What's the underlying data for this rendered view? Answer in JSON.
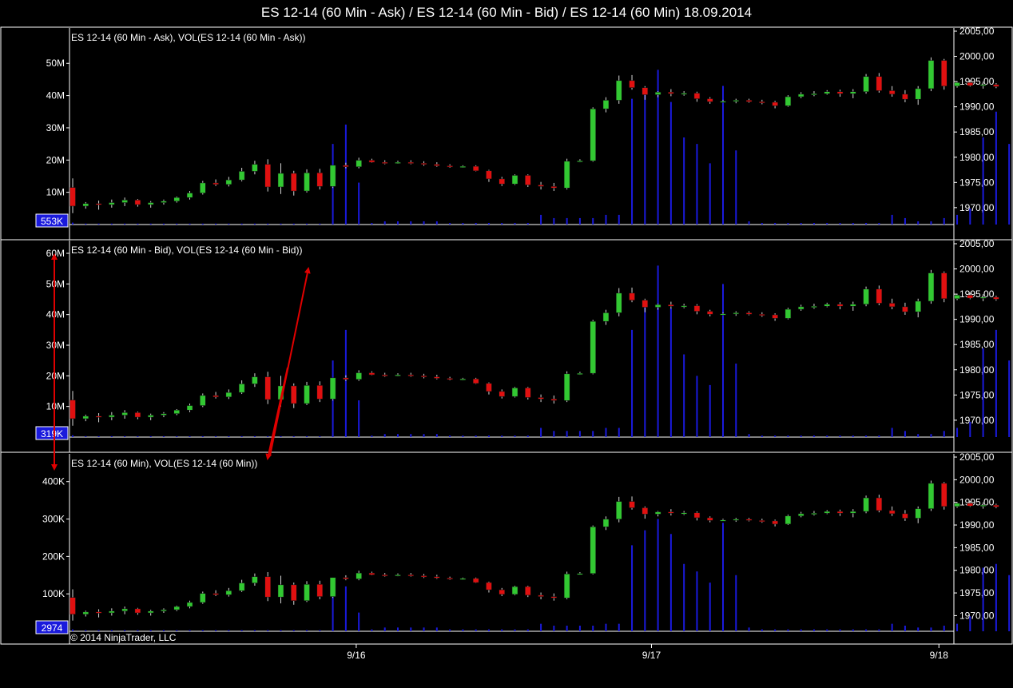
{
  "window": {
    "title": "ES 12-14 (60 Min - Ask) / ES 12-14 (60 Min - Bid) / ES 12-14 (60 Min)  18.09.2014",
    "copyright": "© 2014 NinjaTrader, LLC"
  },
  "colors": {
    "up": "#32c832",
    "down": "#e01010",
    "volume": "#1a1adc",
    "grid_line": "#ffffff",
    "annotation": "#e00000",
    "badge": "#1a1adc"
  },
  "chart_data": [
    {
      "type": "candlestick-with-volume",
      "title": "ES 12-14 (60 Min - Ask), VOL(ES 12-14 (60 Min - Ask))",
      "price_ticks": [
        "2005,00",
        "2000,00",
        "1995,00",
        "1990,00",
        "1985,00",
        "1980,00",
        "1975,00",
        "1970,00"
      ],
      "price_ylim": [
        1967.6,
        2005.0
      ],
      "volume_ticks": [
        "50M",
        "40M",
        "30M",
        "20M",
        "10M"
      ],
      "volume_ylim": [
        0,
        57
      ],
      "last_volume_label": "553K",
      "volume_unit": "M",
      "volume": [
        0.6,
        0.3,
        0.3,
        0.3,
        0.3,
        0.3,
        0.3,
        0.3,
        0.3,
        0.3,
        0.3,
        0.3,
        0.3,
        0.3,
        0.3,
        0.3,
        0.3,
        0.3,
        0.3,
        0.3,
        25,
        31,
        13,
        0.5,
        1,
        1,
        1,
        1,
        1,
        0.5,
        0.5,
        0.5,
        0.5,
        0.5,
        0.5,
        0.5,
        3,
        2,
        2,
        2,
        2,
        3,
        3,
        39,
        42,
        48,
        38,
        27,
        25,
        19,
        43,
        23,
        1,
        0.5,
        0.5,
        0.5,
        0.5,
        0.5,
        0.5,
        0.5,
        0.5,
        0.5,
        0.5,
        3,
        2,
        1,
        1,
        2,
        3,
        5,
        27,
        35,
        25,
        13,
        12,
        21,
        25,
        52,
        17,
        0.5
      ]
    },
    {
      "type": "candlestick-with-volume",
      "title": "ES 12-14 (60 Min - Bid), VOL(ES 12-14 (60 Min - Bid))",
      "price_ticks": [
        "2005,00",
        "2000,00",
        "1995,00",
        "1990,00",
        "1985,00",
        "1980,00",
        "1975,00",
        "1970,00"
      ],
      "price_ylim": [
        1967.6,
        2005.0
      ],
      "volume_ticks": [
        "60M",
        "50M",
        "40M",
        "30M",
        "20M",
        "10M"
      ],
      "volume_ylim": [
        0,
        60
      ],
      "last_volume_label": "319K",
      "volume_unit": "M",
      "volume": [
        0.6,
        0.3,
        0.3,
        0.3,
        0.3,
        0.3,
        0.3,
        0.3,
        0.3,
        0.3,
        0.3,
        0.3,
        0.3,
        0.3,
        0.3,
        0.3,
        0.3,
        0.3,
        0.3,
        0.3,
        25,
        35,
        12,
        0.5,
        1,
        1,
        1,
        1,
        1,
        0.5,
        0.5,
        0.5,
        0.5,
        0.5,
        0.5,
        0.5,
        3,
        2,
        2,
        2,
        2,
        3,
        3,
        35,
        44,
        56,
        42,
        27,
        20,
        17,
        50,
        24,
        1,
        0.5,
        0.5,
        0.5,
        0.5,
        0.5,
        0.5,
        0.5,
        0.5,
        0.5,
        0.5,
        3,
        2,
        1,
        1,
        2,
        3,
        5,
        29,
        35,
        25,
        13,
        12,
        20,
        25,
        57,
        16,
        0.5
      ]
    },
    {
      "type": "candlestick-with-volume",
      "title": "ES 12-14 (60 Min), VOL(ES 12-14 (60 Min))",
      "price_ticks": [
        "2005,00",
        "2000,00",
        "1995,00",
        "1990,00",
        "1985,00",
        "1980,00",
        "1975,00",
        "1970,00"
      ],
      "price_ylim": [
        1967.6,
        2005.0
      ],
      "volume_ticks": [
        "400K",
        "300K",
        "200K",
        "100K"
      ],
      "volume_ylim": [
        0,
        440
      ],
      "last_volume_label": "2974",
      "volume_unit": "K",
      "volume": [
        5,
        3,
        3,
        3,
        3,
        3,
        3,
        3,
        3,
        3,
        3,
        3,
        3,
        3,
        3,
        3,
        3,
        3,
        3,
        3,
        140,
        120,
        50,
        5,
        10,
        10,
        10,
        10,
        10,
        5,
        5,
        5,
        5,
        5,
        5,
        5,
        20,
        15,
        15,
        15,
        15,
        20,
        20,
        230,
        270,
        300,
        260,
        180,
        160,
        130,
        290,
        150,
        10,
        5,
        5,
        5,
        5,
        5,
        5,
        5,
        5,
        5,
        5,
        20,
        15,
        10,
        10,
        15,
        20,
        40,
        170,
        180,
        150,
        90,
        80,
        150,
        420,
        430,
        70,
        5
      ]
    }
  ],
  "ohlc": [
    [
      1974.0,
      1975.8,
      1968.9,
      1970.3
    ],
    [
      1970.3,
      1971.1,
      1969.8,
      1970.8
    ],
    [
      1970.8,
      1971.4,
      1969.6,
      1970.6
    ],
    [
      1970.6,
      1971.6,
      1970.0,
      1971.0
    ],
    [
      1971.0,
      1972.0,
      1970.3,
      1971.5
    ],
    [
      1971.5,
      1971.7,
      1970.2,
      1970.6
    ],
    [
      1970.6,
      1971.3,
      1970.0,
      1971.0
    ],
    [
      1971.0,
      1971.6,
      1970.6,
      1971.3
    ],
    [
      1971.3,
      1972.2,
      1971.0,
      1972.0
    ],
    [
      1972.0,
      1973.3,
      1971.6,
      1972.9
    ],
    [
      1972.9,
      1975.3,
      1972.6,
      1974.9
    ],
    [
      1974.9,
      1975.6,
      1974.3,
      1974.6
    ],
    [
      1974.6,
      1976.1,
      1974.2,
      1975.5
    ],
    [
      1975.5,
      1977.9,
      1975.2,
      1977.2
    ],
    [
      1977.2,
      1979.3,
      1976.6,
      1978.6
    ],
    [
      1978.6,
      1979.6,
      1973.2,
      1974.1
    ],
    [
      1974.1,
      1978.8,
      1972.7,
      1976.8
    ],
    [
      1976.8,
      1977.3,
      1972.4,
      1973.3
    ],
    [
      1973.3,
      1977.6,
      1973.0,
      1976.9
    ],
    [
      1976.9,
      1977.7,
      1973.6,
      1974.2
    ],
    [
      1974.2,
      1978.4,
      1973.9,
      1978.4
    ],
    [
      1978.4,
      1978.9,
      1977.8,
      1978.1
    ],
    [
      1978.1,
      1979.9,
      1977.8,
      1979.4
    ],
    [
      1979.4,
      1979.7,
      1978.9,
      1979.0
    ],
    [
      1979.0,
      1979.4,
      1978.6,
      1978.9
    ],
    [
      1978.9,
      1979.3,
      1978.7,
      1979.0
    ],
    [
      1979.0,
      1979.4,
      1978.6,
      1978.8
    ],
    [
      1978.8,
      1979.2,
      1978.3,
      1978.6
    ],
    [
      1978.6,
      1979.0,
      1978.1,
      1978.3
    ],
    [
      1978.3,
      1978.6,
      1977.9,
      1978.1
    ],
    [
      1978.1,
      1978.4,
      1977.9,
      1978.2
    ],
    [
      1978.2,
      1978.4,
      1977.2,
      1977.3
    ],
    [
      1977.3,
      1977.5,
      1975.1,
      1975.7
    ],
    [
      1975.7,
      1976.1,
      1974.3,
      1974.7
    ],
    [
      1974.7,
      1976.6,
      1974.5,
      1976.4
    ],
    [
      1976.4,
      1976.6,
      1974.1,
      1974.5
    ],
    [
      1974.5,
      1975.1,
      1973.6,
      1974.2
    ],
    [
      1974.2,
      1974.9,
      1973.3,
      1973.9
    ],
    [
      1973.9,
      1979.7,
      1973.6,
      1979.2
    ],
    [
      1979.2,
      1979.6,
      1979.0,
      1979.3
    ],
    [
      1979.3,
      1989.9,
      1979.1,
      1989.6
    ],
    [
      1989.6,
      1991.9,
      1988.9,
      1991.3
    ],
    [
      1991.3,
      1996.2,
      1990.6,
      1995.2
    ],
    [
      1995.2,
      1996.3,
      1993.4,
      1993.8
    ],
    [
      1993.8,
      1994.1,
      1991.4,
      1992.4
    ],
    [
      1992.4,
      1993.1,
      1991.9,
      1992.9
    ],
    [
      1992.9,
      1993.5,
      1992.1,
      1992.6
    ],
    [
      1992.6,
      1993.1,
      1992.2,
      1992.7
    ],
    [
      1992.7,
      1993.0,
      1991.0,
      1991.6
    ],
    [
      1991.6,
      1991.9,
      1990.6,
      1991.0
    ],
    [
      1991.0,
      1991.4,
      1990.9,
      1991.1
    ],
    [
      1991.1,
      1991.6,
      1990.7,
      1991.3
    ],
    [
      1991.3,
      1991.6,
      1990.8,
      1991.0
    ],
    [
      1991.0,
      1991.4,
      1990.5,
      1990.9
    ],
    [
      1990.9,
      1991.2,
      1989.7,
      1990.2
    ],
    [
      1990.2,
      1992.3,
      1990.0,
      1992.0
    ],
    [
      1992.0,
      1992.9,
      1991.7,
      1992.5
    ],
    [
      1992.5,
      1993.1,
      1992.1,
      1992.6
    ],
    [
      1992.6,
      1993.3,
      1992.4,
      1993.0
    ],
    [
      1993.0,
      1993.4,
      1992.0,
      1992.6
    ],
    [
      1992.6,
      1993.5,
      1991.7,
      1993.0
    ],
    [
      1993.0,
      1996.5,
      1992.6,
      1996.0
    ],
    [
      1996.0,
      1996.7,
      1992.8,
      1993.2
    ],
    [
      1993.2,
      1994.1,
      1992.0,
      1992.5
    ],
    [
      1992.5,
      1993.3,
      1990.9,
      1991.5
    ],
    [
      1991.5,
      1994.1,
      1990.4,
      1993.6
    ],
    [
      1993.6,
      1999.8,
      1993.1,
      1999.2
    ],
    [
      1999.2,
      1999.5,
      1993.4,
      1994.1
    ],
    [
      1994.1,
      1995.1,
      1993.8,
      1994.8
    ],
    [
      1994.8,
      1995.3,
      1994.0,
      1994.2
    ],
    [
      1994.2,
      1995.0,
      1993.6,
      1994.4
    ],
    [
      1994.4,
      1994.7,
      1993.7,
      1994.0
    ]
  ],
  "axes": {
    "x_ticks": [
      {
        "label": "9/16",
        "index": 21.8
      },
      {
        "label": "9/17",
        "index": 44.5
      },
      {
        "label": "9/18",
        "index": 66.6
      }
    ]
  }
}
